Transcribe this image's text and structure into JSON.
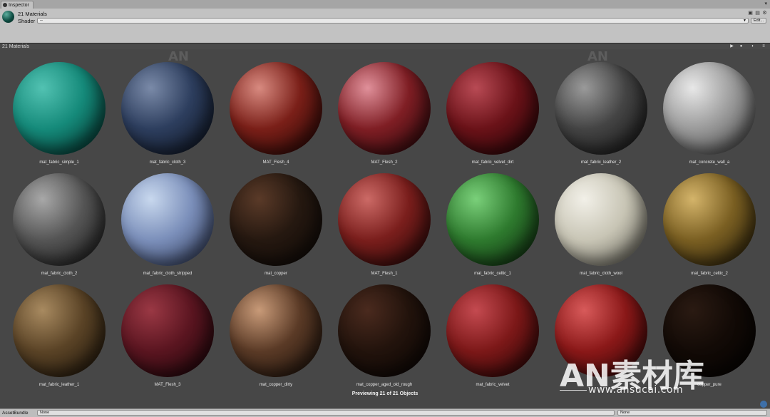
{
  "tab": {
    "label": "Inspector"
  },
  "header": {
    "title": "21 Materials",
    "shader_label": "Shader",
    "shader_value": "--",
    "edit_label": "Edit..."
  },
  "preview": {
    "title": "21 Materials",
    "status": "Previewing 21 of 21 Objects"
  },
  "materials": [
    {
      "name": "mat_fabric_simple_1",
      "light": "#52c2b2",
      "mid": "#158a7a",
      "dark": "#022a25"
    },
    {
      "name": "mat_fabric_cloth_3",
      "light": "#7a8aa8",
      "mid": "#2d3e5e",
      "dark": "#0b111c"
    },
    {
      "name": "MAT_Flesh_4",
      "light": "#d88a80",
      "mid": "#7a1f18",
      "dark": "#200503"
    },
    {
      "name": "MAT_Flesh_2",
      "light": "#e0909a",
      "mid": "#7f1e24",
      "dark": "#200507"
    },
    {
      "name": "mat_fabric_velvet_dirt",
      "light": "#b84a54",
      "mid": "#6a1218",
      "dark": "#1c0305"
    },
    {
      "name": "mat_fabric_leather_2",
      "light": "#9a9a9a",
      "mid": "#444444",
      "dark": "#121212"
    },
    {
      "name": "mat_concrete_wall_a",
      "light": "#e8e8e8",
      "mid": "#9a9a9a",
      "dark": "#3a3a3a"
    },
    {
      "name": "mat_fabric_cloth_2",
      "light": "#a8a8a8",
      "mid": "#555555",
      "dark": "#161616"
    },
    {
      "name": "mat_fabric_cloth_stripped",
      "light": "#c8d8ee",
      "mid": "#7b8fba",
      "dark": "#283250"
    },
    {
      "name": "mat_copper",
      "light": "#5a3a28",
      "mid": "#251810",
      "dark": "#0c0806"
    },
    {
      "name": "MAT_Flesh_1",
      "light": "#cc6a66",
      "mid": "#7a1e1c",
      "dark": "#200605"
    },
    {
      "name": "mat_fabric_celtic_1",
      "light": "#7ad07a",
      "mid": "#2e7a2e",
      "dark": "#0b220b"
    },
    {
      "name": "mat_fabric_cloth_wool",
      "light": "#f2f0e8",
      "mid": "#c8c5b5",
      "dark": "#5c5a50"
    },
    {
      "name": "mat_fabric_celtic_2",
      "light": "#d4b46a",
      "mid": "#7a5f22",
      "dark": "#221a08"
    },
    {
      "name": "mat_fabric_leather_1",
      "light": "#a88a60",
      "mid": "#5a4326",
      "dark": "#1a1208"
    },
    {
      "name": "MAT_Flesh_3",
      "light": "#9a3844",
      "mid": "#5a1520",
      "dark": "#160407"
    },
    {
      "name": "mat_copper_dirty",
      "light": "#c89a78",
      "mid": "#5a3a26",
      "dark": "#170e08"
    },
    {
      "name": "mat_copper_aged_old_rough",
      "light": "#4a2a1e",
      "mid": "#22130c",
      "dark": "#080403"
    },
    {
      "name": "mat_fabric_velvet",
      "light": "#c44a50",
      "mid": "#7c1818",
      "dark": "#200404"
    },
    {
      "name": "",
      "light": "#d85a5a",
      "mid": "#8a1818",
      "dark": "#240404"
    },
    {
      "name": "copper_pure",
      "light": "#2a1a12",
      "mid": "#120a06",
      "dark": "#030201"
    }
  ],
  "watermark": {
    "logo": "AN素材库",
    "url": "www.ansucai.com",
    "small_logo": "AN"
  },
  "footer": {
    "label": "AssetBundle",
    "left_select": "None",
    "right_select": "None"
  }
}
